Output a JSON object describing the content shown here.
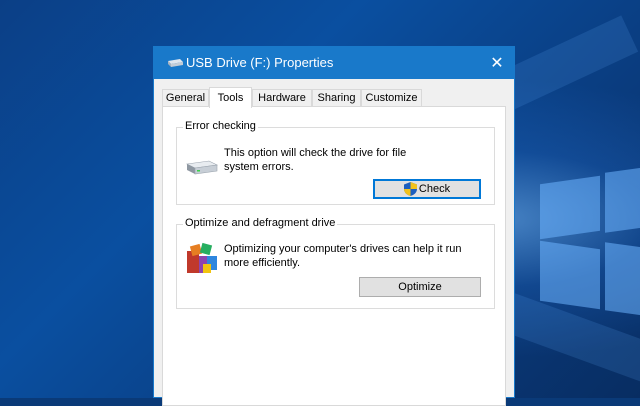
{
  "window": {
    "title": "USB Drive (F:) Properties",
    "close_glyph": "✕"
  },
  "tabs": [
    {
      "label": "General"
    },
    {
      "label": "Tools"
    },
    {
      "label": "Hardware"
    },
    {
      "label": "Sharing"
    },
    {
      "label": "Customize"
    }
  ],
  "active_tab": "Tools",
  "error_checking": {
    "heading": "Error checking",
    "description_line1": "This option will check the drive for file",
    "description_line2": "system errors.",
    "button_label": "Check",
    "icon": "drive-icon"
  },
  "optimize": {
    "heading": "Optimize and defragment drive",
    "description_line1": "Optimizing your computer's drives can help it run",
    "description_line2": "more efficiently.",
    "button_label": "Optimize",
    "icon": "defrag-icon"
  },
  "colors": {
    "titlebar": "#1979ca",
    "accent": "#0078d7"
  }
}
